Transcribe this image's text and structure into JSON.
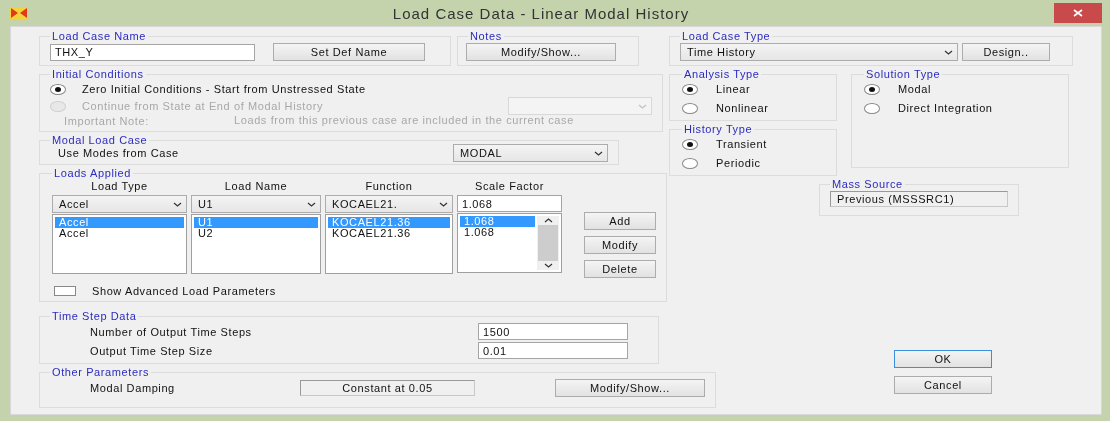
{
  "window": {
    "title": "Load Case Data - Linear Modal History"
  },
  "load_case_name": {
    "label": "Load Case Name",
    "value": "THX_Y",
    "button": "Set Def Name"
  },
  "notes": {
    "label": "Notes",
    "button": "Modify/Show..."
  },
  "load_case_type": {
    "label": "Load Case Type",
    "value": "Time History",
    "button": "Design.."
  },
  "initial_conditions": {
    "label": "Initial Conditions",
    "options": [
      {
        "label": "Zero Initial Conditions - Start from Unstressed State",
        "selected": true,
        "disabled": false
      },
      {
        "label": "Continue from State at End of Modal History",
        "selected": false,
        "disabled": true
      }
    ],
    "note_label": "Important Note:",
    "note": "Loads from this previous case are included in the current case"
  },
  "analysis_type": {
    "label": "Analysis Type",
    "options": [
      {
        "label": "Linear",
        "selected": true
      },
      {
        "label": "Nonlinear",
        "selected": false
      }
    ]
  },
  "history_type": {
    "label": "History Type",
    "options": [
      {
        "label": "Transient",
        "selected": true
      },
      {
        "label": "Periodic",
        "selected": false
      }
    ]
  },
  "solution_type": {
    "label": "Solution Type",
    "options": [
      {
        "label": "Modal",
        "selected": true
      },
      {
        "label": "Direct Integration",
        "selected": false
      }
    ]
  },
  "modal_load_case": {
    "label": "Modal Load Case",
    "field_label": "Use Modes from Case",
    "value": "MODAL"
  },
  "loads_applied": {
    "label": "Loads Applied",
    "columns": [
      "Load Type",
      "Load Name",
      "Function",
      "Scale Factor"
    ],
    "editor": [
      "Accel",
      "U1",
      "KOCAEL21.",
      "1.068"
    ],
    "rows": [
      {
        "cells": [
          "Accel",
          "U1",
          "KOCAEL21.36",
          "1.068"
        ],
        "selected": true
      },
      {
        "cells": [
          "Accel",
          "U2",
          "KOCAEL21.36",
          "1.068"
        ],
        "selected": false
      }
    ],
    "buttons": [
      "Add",
      "Modify",
      "Delete"
    ],
    "advanced": {
      "label": "Show Advanced Load Parameters",
      "checked": false
    }
  },
  "mass_source": {
    "label": "Mass Source",
    "value": "Previous (MSSSRC1)"
  },
  "time_step_data": {
    "label": "Time Step Data",
    "fields": [
      {
        "label": "Number of Output Time Steps",
        "value": "1500"
      },
      {
        "label": "Output Time Step Size",
        "value": "0.01"
      }
    ]
  },
  "other_parameters": {
    "label": "Other Parameters",
    "field_label": "Modal Damping",
    "value": "Constant at 0.05",
    "button": "Modify/Show..."
  },
  "buttons": [
    {
      "label": "OK",
      "default": true
    },
    {
      "label": "Cancel",
      "default": false
    }
  ]
}
